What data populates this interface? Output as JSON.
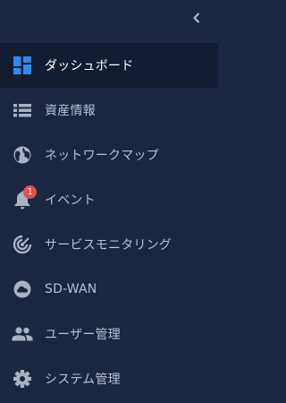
{
  "sidebar": {
    "collapse_icon": "chevron-left-icon",
    "items": [
      {
        "label": "ダッシュボード",
        "icon": "dashboard-icon",
        "active": true
      },
      {
        "label": "資産情報",
        "icon": "list-icon"
      },
      {
        "label": "ネットワークマップ",
        "icon": "globe-icon"
      },
      {
        "label": "イベント",
        "icon": "bell-icon",
        "badge": "1"
      },
      {
        "label": "サービスモニタリング",
        "icon": "radar-icon"
      },
      {
        "label": "SD-WAN",
        "icon": "cloud-icon"
      },
      {
        "label": "ユーザー管理",
        "icon": "users-icon"
      },
      {
        "label": "システム管理",
        "icon": "gear-icon"
      }
    ]
  },
  "colors": {
    "background": "#1b2640",
    "active_background": "#131c30",
    "active_icon": "#2e8cf0",
    "icon": "#a9b2c1",
    "text": "#b7c0cf",
    "active_text": "#ffffff",
    "badge": "#e0504f"
  }
}
